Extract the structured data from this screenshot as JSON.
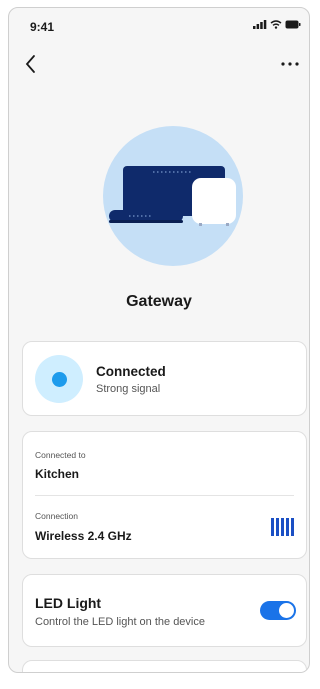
{
  "status_bar": {
    "time": "9:41"
  },
  "device": {
    "name": "Gateway"
  },
  "connection_status": {
    "title": "Connected",
    "subtitle": "Strong signal"
  },
  "details": {
    "connected_to_label": "Connected to",
    "connected_to_value": "Kitchen",
    "connection_label": "Connection",
    "connection_value": "Wireless 2.4 GHz"
  },
  "led": {
    "title": "LED Light",
    "subtitle": "Control the LED light on the device",
    "enabled": true
  },
  "icons": {
    "back": "chevron-left-icon",
    "more": "more-horizontal-icon",
    "signal": "signal-strength-icon",
    "wifi": "wifi-icon",
    "battery": "battery-icon"
  },
  "colors": {
    "accent": "#1a73e8",
    "status_dot": "#1e9bec",
    "status_halo": "#cfeeff",
    "hero_circle": "#c5dff6",
    "device_navy": "#0f2a6b"
  }
}
